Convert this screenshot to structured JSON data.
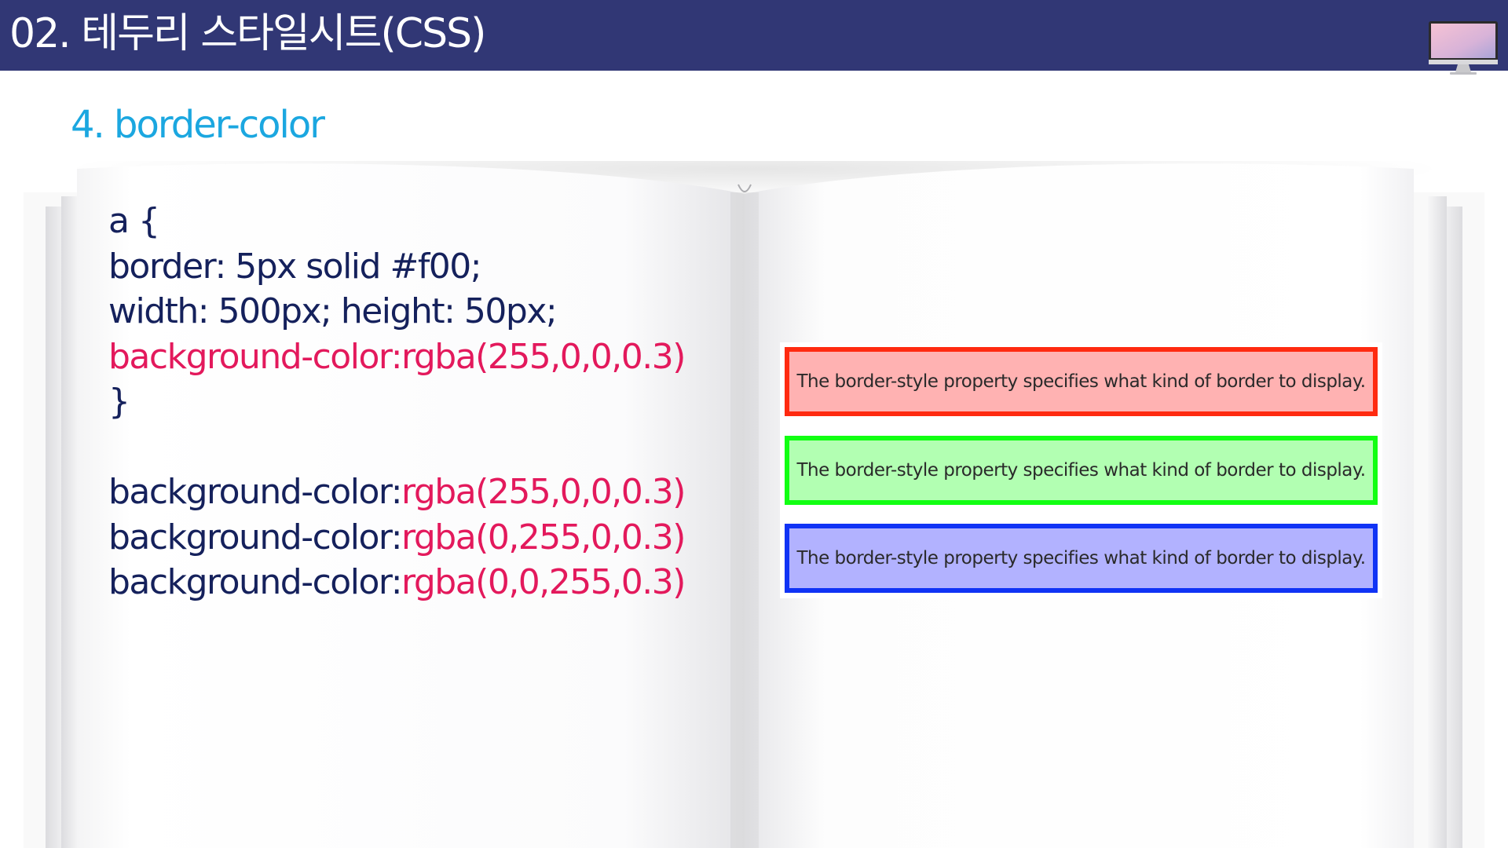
{
  "header": {
    "title": "02. 테두리 스타일시트(CSS)",
    "bar_color": "#313775",
    "icon": "monitor-icon"
  },
  "section": {
    "heading": "4. border-color",
    "heading_color": "#1ba7e0"
  },
  "code": {
    "text_color": "#15215c",
    "highlight_color": "#e3195c",
    "block1": {
      "open": "a {",
      "line_border": "border: 5px solid #f00;",
      "line_size": "width: 500px; height: 50px;",
      "line_bg": "background-color:rgba(255,0,0,0.3)",
      "close": "}"
    },
    "block2": [
      {
        "prop": "background-color:",
        "value": "rgba(255,0,0,0.3)"
      },
      {
        "prop": "background-color:",
        "value": "rgba(0,255,0,0.3)"
      },
      {
        "prop": "background-color:",
        "value": "rgba(0,0,255,0.3)"
      }
    ]
  },
  "demo": {
    "boxes": [
      {
        "text": "The border-style property specifies what kind of border to display.",
        "border_color": "#ff2a10",
        "background": "rgba(255,0,0,0.3)"
      },
      {
        "text": "The border-style property specifies what kind of border to display.",
        "border_color": "#11ff12",
        "background": "rgba(0,255,0,0.3)"
      },
      {
        "text": "The border-style property specifies what kind of border to display.",
        "border_color": "#1033f5",
        "background": "rgba(0,0,255,0.3)"
      }
    ]
  }
}
